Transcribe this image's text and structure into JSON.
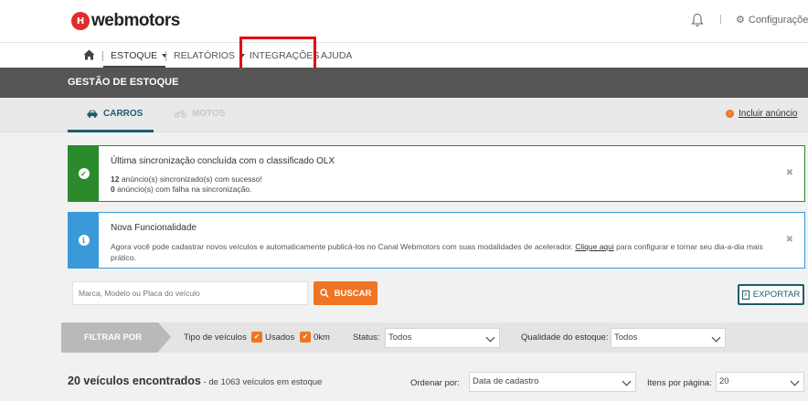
{
  "brand": {
    "logo_mark": "H",
    "logo_text": "webmotors"
  },
  "topbar": {
    "config_label": "Configurações"
  },
  "nav": {
    "estoque": "ESTOQUE",
    "relatorios": "RELATÓRIOS",
    "integracoes": "INTEGRAÇÕES",
    "ajuda": "AJUDA"
  },
  "header": {
    "title": "GESTÃO DE ESTOQUE"
  },
  "tabs": {
    "carros": "CARROS",
    "motos": "MOTOS",
    "incluir": "Incluir anúncio"
  },
  "alert_success": {
    "title": "Última sincronização concluída com o classificado OLX",
    "success_count": "12",
    "success_text": " anúncio(s) sincronizado(s) com sucesso!",
    "fail_count": "0",
    "fail_text": " anúncio(s) com falha na sincronização."
  },
  "alert_info": {
    "title": "Nova Funcionalidade",
    "text_before": "Agora você pode cadastrar novos veículos e automaticamente publicá-los no Canal Webmotors com suas modalidades de acelerador. ",
    "link": "Clique aqui",
    "text_after": " para configurar e tornar seu dia-a-dia mais prático."
  },
  "search": {
    "placeholder": "Marca, Modelo ou Placa do veículo",
    "button": "BUSCAR"
  },
  "export_button": "EXPORTAR",
  "filters": {
    "filtrar_por": "FILTRAR POR",
    "tipo_label": "Tipo de veículos",
    "usados": "Usados",
    "zerokm": "0km",
    "status_label": "Status:",
    "status_value": "Todos",
    "qualidade_label": "Qualidade do estoque:",
    "qualidade_value": "Todos"
  },
  "results": {
    "count": "20 veículos encontrados",
    "sub": " - de 1063 veículos em estoque",
    "ordenar_label": "Ordenar por:",
    "ordenar_value": "Data de cadastro",
    "itens_label": "Itens por página:",
    "itens_value": "20"
  },
  "colors": {
    "accent": "#f07522",
    "teal": "#1f5c6e",
    "success": "#2b8a2b",
    "info": "#3a9ad9",
    "highlight": "#e30613"
  }
}
